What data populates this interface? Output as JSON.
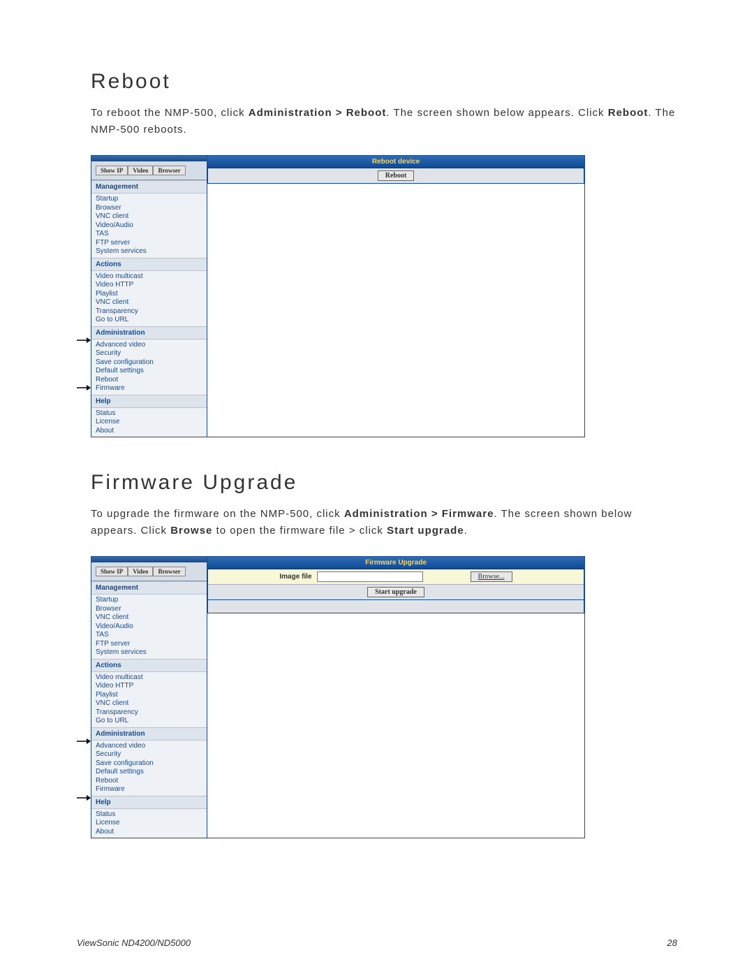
{
  "section1": {
    "heading": "Reboot",
    "desc_plain1": "To reboot the NMP-500, click ",
    "desc_bold1": "Administration > Reboot",
    "desc_plain2": ". The screen shown below appears. Click ",
    "desc_bold2": "Reboot",
    "desc_plain3": ". The NMP-500 reboots."
  },
  "section2": {
    "heading": "Firmware Upgrade",
    "desc_plain1": "To upgrade the firmware on the NMP-500, click ",
    "desc_bold1": "Administration > Firmware",
    "desc_plain2": ". The screen shown below appears. Click ",
    "desc_bold2": "Browse",
    "desc_plain3": " to open the firmware file > click ",
    "desc_bold3": "Start upgrade",
    "desc_plain4": "."
  },
  "sidebar": {
    "tabs": [
      "Show IP",
      "Video",
      "Browser"
    ],
    "groups": [
      {
        "title": "Management",
        "items": [
          "Startup",
          "Browser",
          "VNC client",
          "Video/Audio",
          "TAS",
          "FTP server",
          "System services"
        ]
      },
      {
        "title": "Actions",
        "items": [
          "Video multicast",
          "Video HTTP",
          "Playlist",
          "VNC client",
          "Transparency",
          "Go to URL"
        ]
      },
      {
        "title": "Administration",
        "items": [
          "Advanced video",
          "Security",
          "Save configuration",
          "Default settings",
          "Reboot",
          "Firmware"
        ]
      },
      {
        "title": "Help",
        "items": [
          "Status",
          "License",
          "About"
        ]
      }
    ]
  },
  "panel1": {
    "title": "Reboot device",
    "button": "Reboot"
  },
  "panel2": {
    "title": "Firmware Upgrade",
    "label": "Image file",
    "browse": "Browse...",
    "start": "Start upgrade"
  },
  "footer": {
    "left": "ViewSonic ND4200/ND5000",
    "right": "28"
  }
}
